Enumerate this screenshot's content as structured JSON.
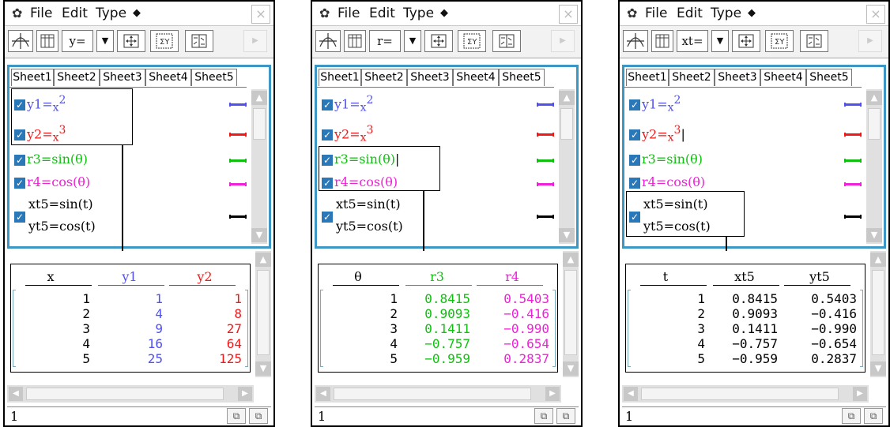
{
  "menu": {
    "file": "File",
    "edit": "Edit",
    "type": "Type",
    "type_arrow": "◆",
    "close": "×"
  },
  "colors": {
    "blue": "#5050f0",
    "red": "#f01818",
    "green": "#10c010",
    "magenta": "#f020d8",
    "black": "#000000",
    "accent": "#3c97c5"
  },
  "tabs": [
    "Sheet1",
    "Sheet2",
    "Sheet3",
    "Sheet4",
    "Sheet5"
  ],
  "functions": {
    "f1": {
      "name": "y1=",
      "base": "x",
      "exp": "2"
    },
    "f2": {
      "name": "y2=",
      "base": "x",
      "exp": "3"
    },
    "f3": {
      "text": "r3=sin(θ)"
    },
    "f4": {
      "text": "r4=cos(θ)"
    },
    "f5a": {
      "text": "xt5=sin(t)"
    },
    "f5b": {
      "text": "yt5=cos(t)"
    }
  },
  "screens": [
    {
      "type_button": "y=",
      "headers": [
        "x",
        "y1",
        "y2"
      ],
      "rows": [
        [
          "1",
          "1",
          "1"
        ],
        [
          "2",
          "4",
          "8"
        ],
        [
          "3",
          "9",
          "27"
        ],
        [
          "4",
          "16",
          "64"
        ],
        [
          "5",
          "25",
          "125"
        ]
      ]
    },
    {
      "type_button": "r=",
      "headers": [
        "θ",
        "r3",
        "r4"
      ],
      "rows": [
        [
          "1",
          "0.8415",
          "0.5403"
        ],
        [
          "2",
          "0.9093",
          "−0.416"
        ],
        [
          "3",
          "0.1411",
          "−0.990"
        ],
        [
          "4",
          "−0.757",
          "−0.654"
        ],
        [
          "5",
          "−0.959",
          "0.2837"
        ]
      ]
    },
    {
      "type_button": "xt=",
      "headers": [
        "t",
        "xt5",
        "yt5"
      ],
      "rows": [
        [
          "1",
          "0.8415",
          "0.5403"
        ],
        [
          "2",
          "0.9093",
          "−0.416"
        ],
        [
          "3",
          "0.1411",
          "−0.990"
        ],
        [
          "4",
          "−0.757",
          "−0.654"
        ],
        [
          "5",
          "−0.959",
          "0.2837"
        ]
      ]
    }
  ],
  "entry_value": "1"
}
